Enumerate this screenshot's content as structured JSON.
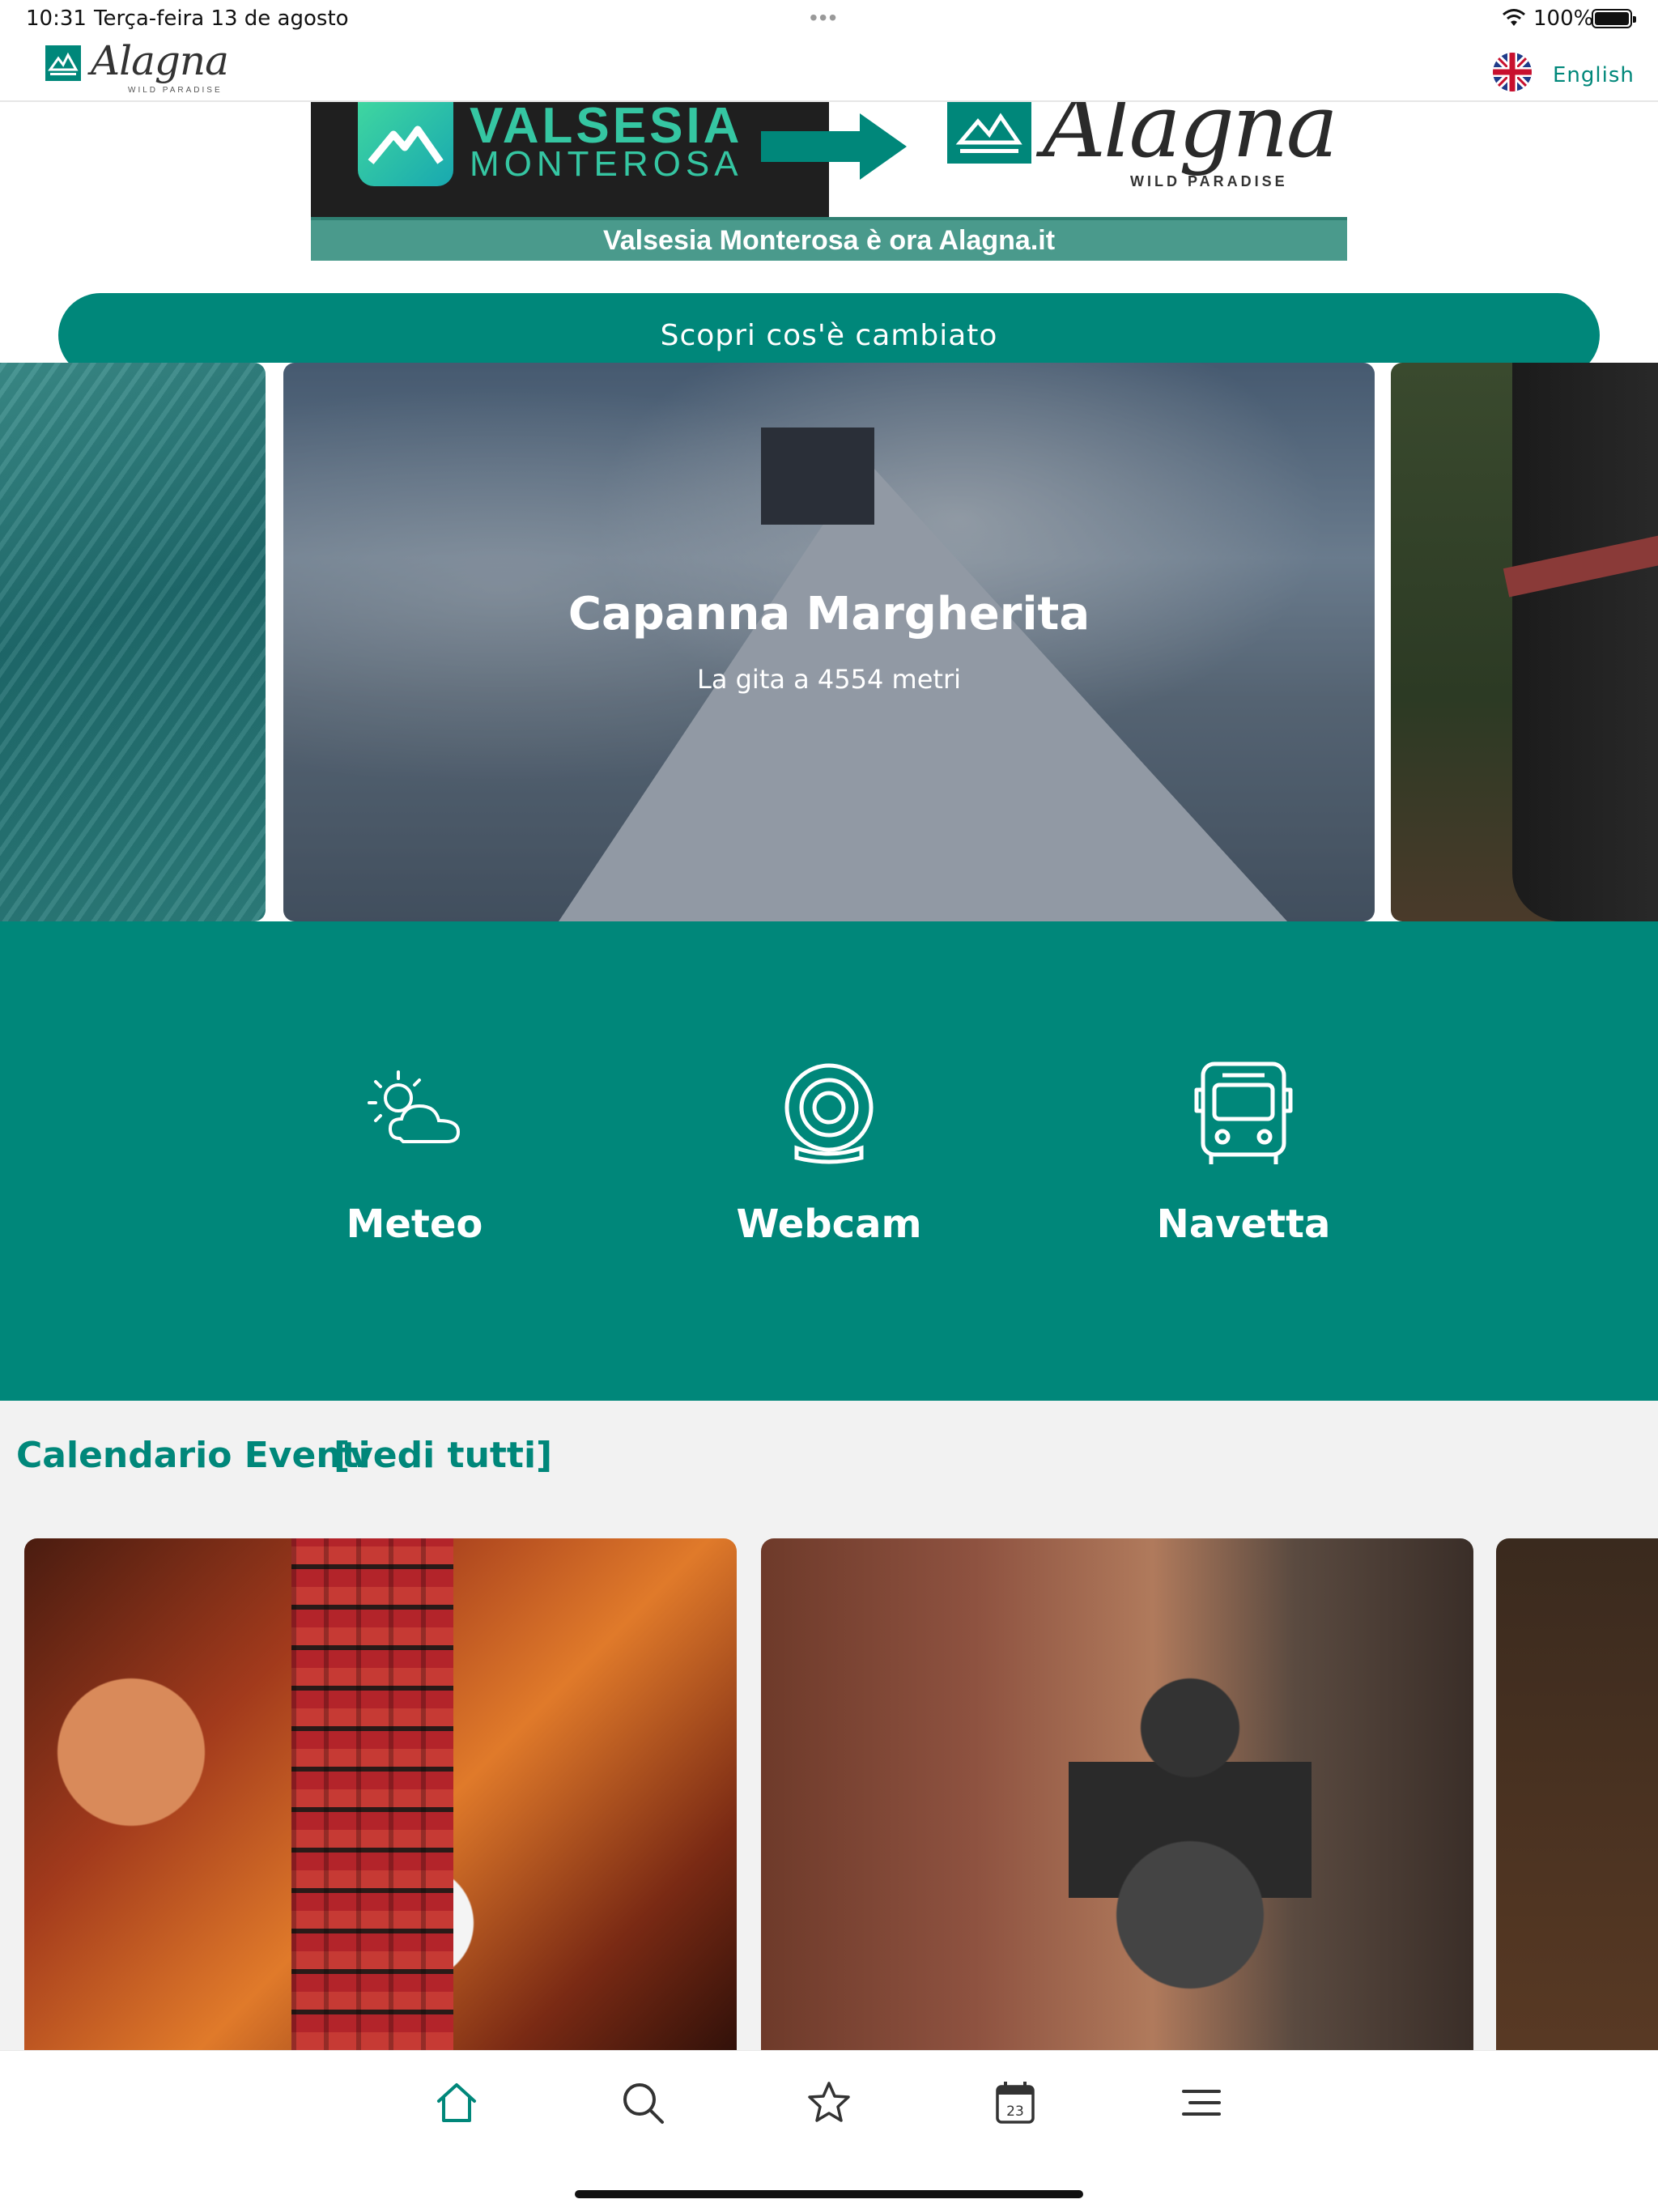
{
  "status_bar": {
    "time": "10:31",
    "date": "Terça-feira 13 de agosto",
    "battery": "100%"
  },
  "header": {
    "logo_text": "Alagna",
    "logo_tagline": "WILD PARADISE",
    "language": "English"
  },
  "banner": {
    "left_title": "VALSESIA",
    "left_subtitle": "MONTEROSA",
    "right_logo": "Alagna",
    "right_tagline": "WILD PARADISE",
    "strip_text": "Valsesia Monterosa è ora Alagna.it"
  },
  "cta": {
    "label": "Scopri cos'è cambiato"
  },
  "carousel": {
    "active_slide": {
      "title": "Capanna Margherita",
      "subtitle": "La gita a 4554 metri"
    }
  },
  "services": [
    {
      "label": "Meteo",
      "icon": "weather-icon"
    },
    {
      "label": "Webcam",
      "icon": "webcam-icon"
    },
    {
      "label": "Navetta",
      "icon": "bus-icon"
    }
  ],
  "events": {
    "heading": "Calendario Eventi",
    "see_all": "[vedi tutti]"
  },
  "tab_bar": {
    "items": [
      "home-icon",
      "search-icon",
      "star-icon",
      "calendar-icon",
      "menu-icon"
    ],
    "calendar_day": "23",
    "active": "home-icon"
  },
  "colors": {
    "brand": "#00877a",
    "background": "#f2f2f2"
  }
}
